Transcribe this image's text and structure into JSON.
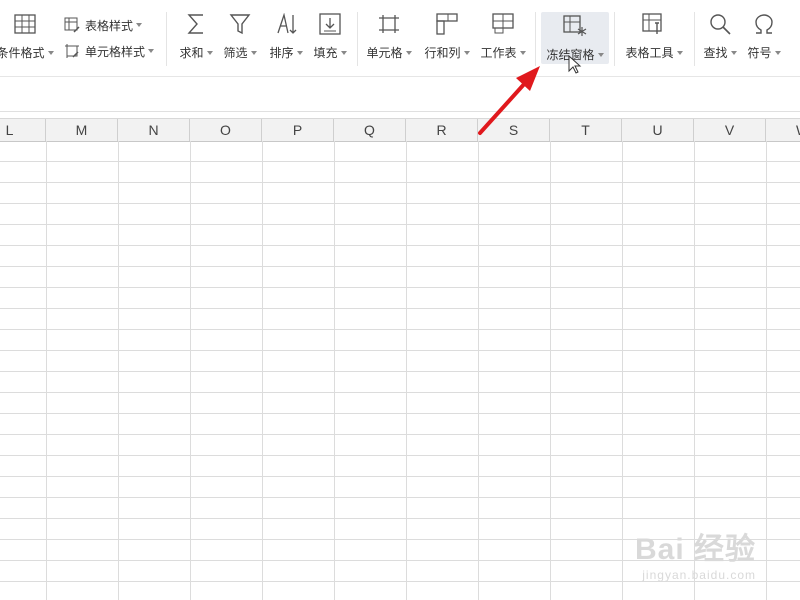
{
  "ribbon": {
    "conditional_format": "条件格式",
    "table_style": "表格样式",
    "cell_style": "单元格样式",
    "sum": "求和",
    "filter": "筛选",
    "sort": "排序",
    "fill": "填充",
    "cell": "单元格",
    "row_col": "行和列",
    "worksheet": "工作表",
    "freeze_panes": "冻结窗格",
    "table_tools": "表格工具",
    "find": "查找",
    "symbol": "符号"
  },
  "columns": [
    "L",
    "M",
    "N",
    "O",
    "P",
    "Q",
    "R",
    "S",
    "T",
    "U",
    "V",
    "W"
  ],
  "watermark": {
    "line1": "Bai 经验",
    "line2": "jingyan.baidu.com"
  },
  "colors": {
    "annotation_arrow": "#e0191d",
    "ribbon_bg": "#ffffff",
    "grid_line": "#dcdcdc"
  }
}
